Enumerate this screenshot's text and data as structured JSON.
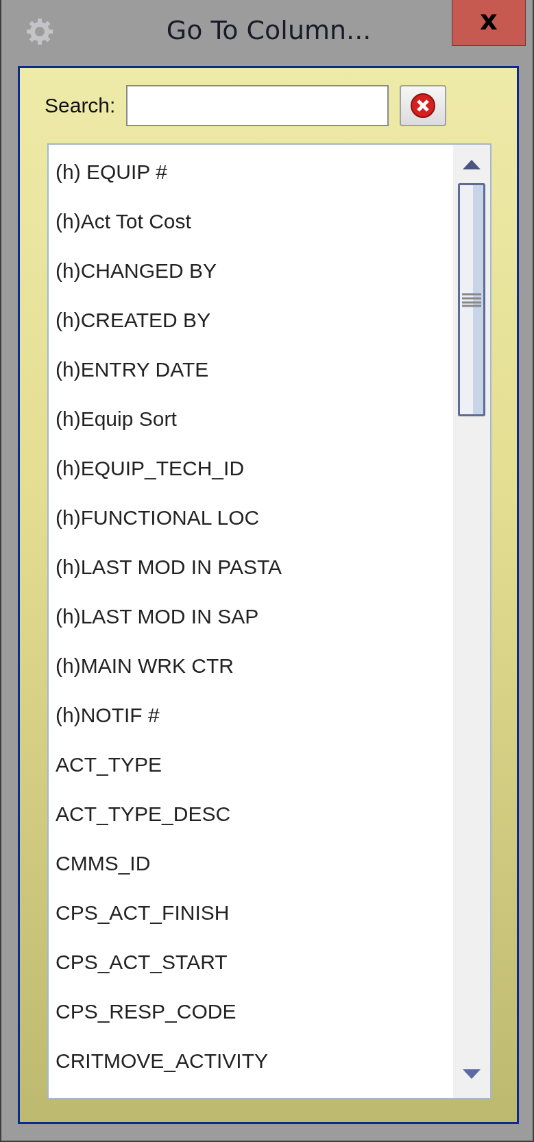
{
  "window": {
    "title": "Go To Column...",
    "close_label": "x"
  },
  "search": {
    "label": "Search:"
  },
  "columns": [
    "(h) EQUIP #",
    "(h)Act Tot Cost",
    "(h)CHANGED BY",
    "(h)CREATED BY",
    "(h)ENTRY DATE",
    "(h)Equip Sort",
    "(h)EQUIP_TECH_ID",
    "(h)FUNCTIONAL LOC",
    "(h)LAST MOD IN PASTA",
    "(h)LAST MOD IN SAP",
    "(h)MAIN WRK CTR",
    "(h)NOTIF #",
    "ACT_TYPE",
    "ACT_TYPE_DESC",
    "CMMS_ID",
    "CPS_ACT_FINISH",
    "CPS_ACT_START",
    "CPS_RESP_CODE",
    "CRITMOVE_ACTIVITY"
  ]
}
